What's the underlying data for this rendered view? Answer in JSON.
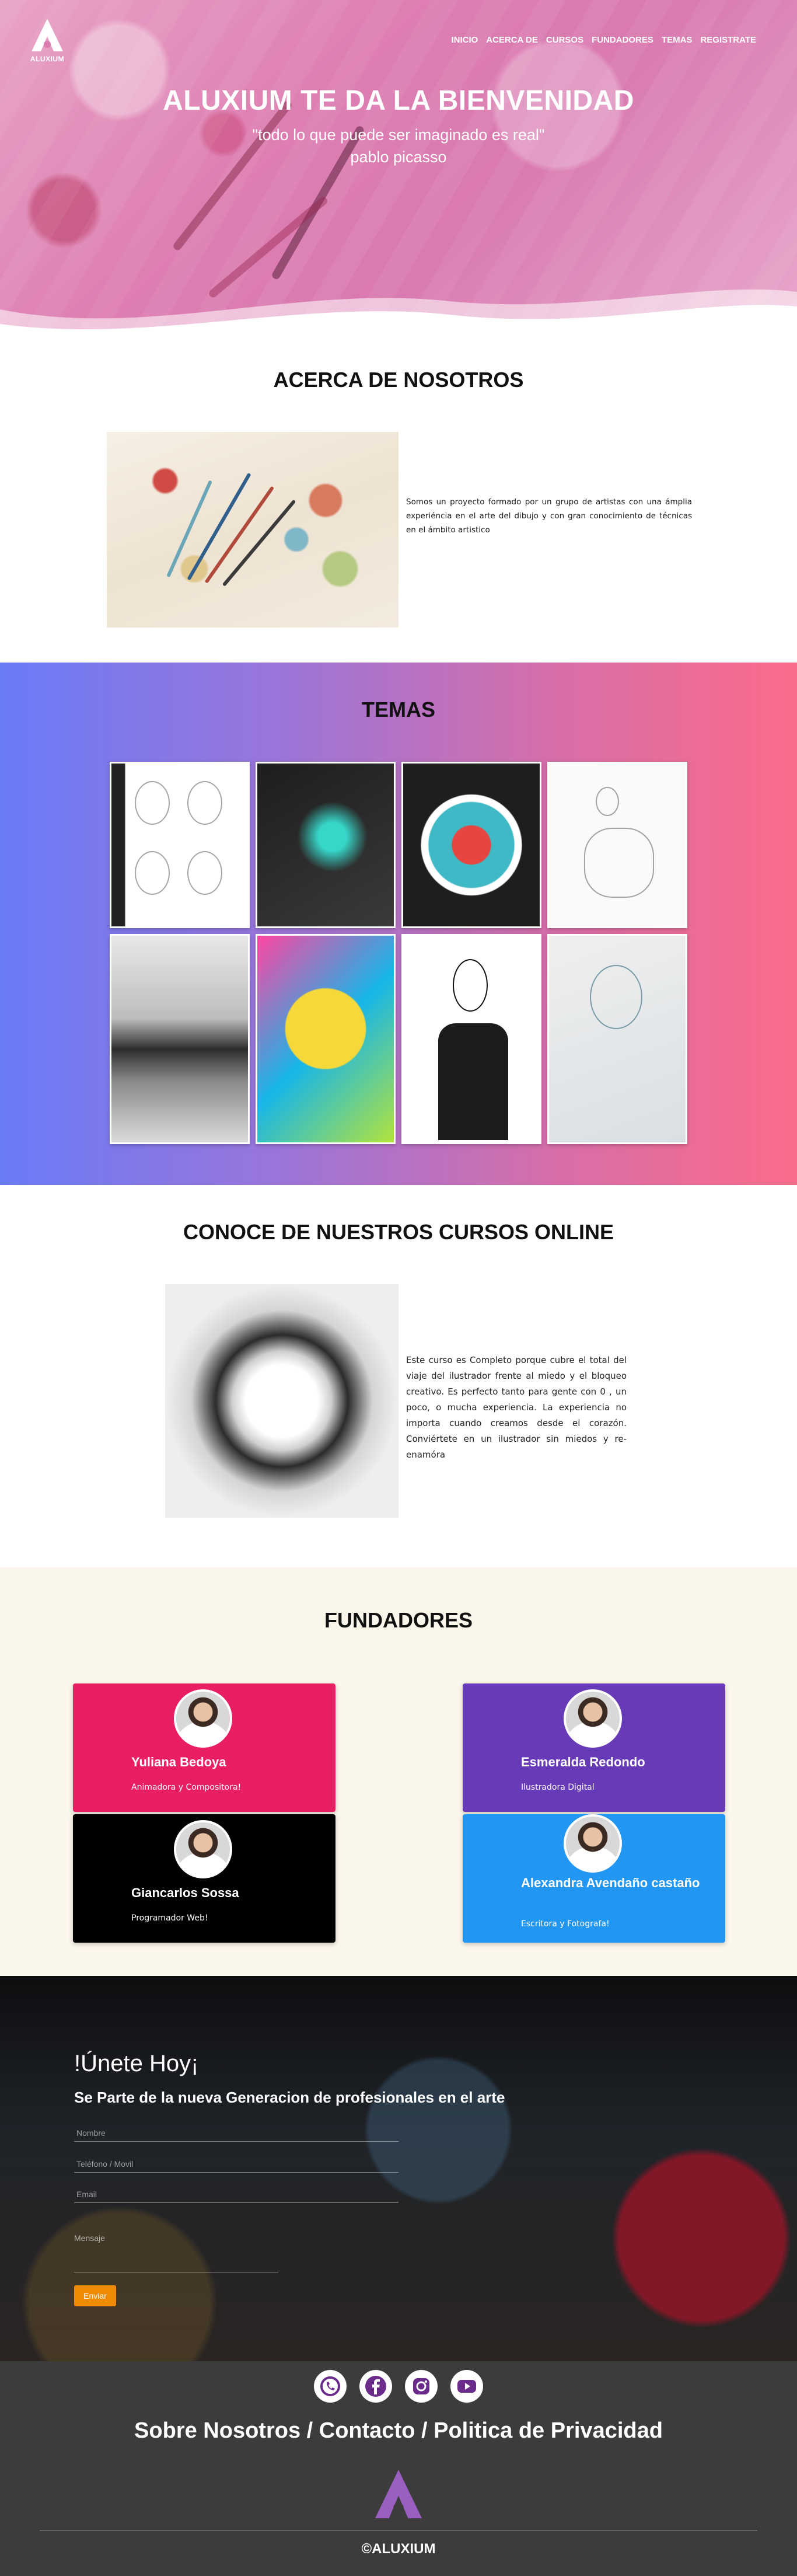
{
  "brand": {
    "logo_text": "ALUXIUM"
  },
  "nav": [
    "INICIO",
    "ACERCA DE",
    "CURSOS",
    "FUNDADORES",
    "TEMAS",
    "REGISTRATE"
  ],
  "hero": {
    "title": "ALUXIUM TE DA LA BIENVENIDAD",
    "quote": "\"todo lo que puede ser imaginado es real\"",
    "author": "pablo picasso"
  },
  "about": {
    "title": "ACERCA DE NOSOTROS",
    "text": "Somos un proyecto formado por un grupo de artistas con una ámplia experiéncia en el arte del dibujo y con gran conocimiento de técnicas en el ámbito artistico"
  },
  "temas": {
    "title": "TEMAS",
    "tile_icons": [
      "face-sketch-image",
      "neon-portrait-image",
      "watercolor-portrait-image",
      "figure-sketch-image",
      "landscape-image",
      "spongebob-image",
      "deer-skull-man-image",
      "tattooed-woman-image"
    ]
  },
  "cursos": {
    "title": "CONOCE DE NUESTROS CURSOS ONLINE",
    "text": "Este curso es Completo porque cubre el total del viaje del ilustrador frente al miedo y el bloqueo creativo. Es perfecto tanto para gente con 0 , un poco, o mucha experiencia. La experiencia no importa cuando creamos desde el corazón. Conviértete en un ilustrador sin miedos y re-enamóra"
  },
  "fundadores": {
    "title": "FUNDADORES",
    "people": [
      {
        "name": "Yuliana Bedoya",
        "role": "Animadora y Compositora!",
        "color": "#e91e63"
      },
      {
        "name": "Esmeralda Redondo",
        "role": "Ilustradora Digital",
        "color": "#673ab7"
      },
      {
        "name": "Giancarlos Sossa",
        "role": "Programador Web!",
        "color": "#000000"
      },
      {
        "name": "Alexandra Avendaño castaño",
        "role": "Escritora y Fotografa!",
        "color": "#2196f3"
      }
    ]
  },
  "join": {
    "title": "!Únete Hoy¡",
    "subtitle": "Se Parte de la nueva Generacion de profesionales en el arte",
    "name_placeholder": "Nombre",
    "phone_placeholder": "Teléfono / Movil",
    "email_placeholder": "Email",
    "message_label": "Mensaje",
    "send_label": "Enviar",
    "button_color": "#f08a00"
  },
  "footer": {
    "social_icons": [
      "whatsapp-icon",
      "facebook-icon",
      "instagram-icon",
      "youtube-icon"
    ],
    "links": [
      "Sobre Nosotros",
      "Contacto",
      "Politica de Privacidad"
    ],
    "separator": " / ",
    "copyright": "©ALUXIUM"
  }
}
